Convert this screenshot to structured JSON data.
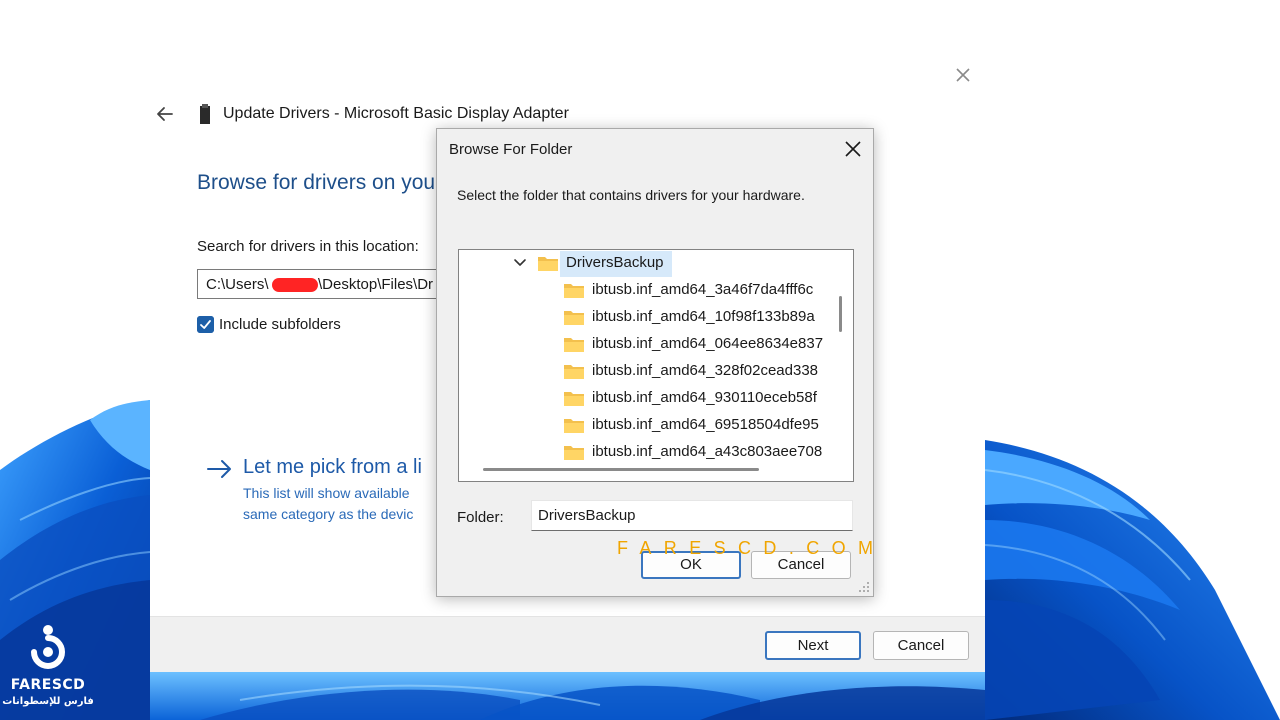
{
  "wizard": {
    "title": "Update Drivers - Microsoft Basic Display Adapter",
    "heading": "Browse for drivers on you",
    "search_label": "Search for drivers in this location:",
    "path_prefix": "C:\\Users\\",
    "path_suffix": "\\Desktop\\Files\\Dr",
    "include_subfolders_label": "Include subfolders",
    "include_subfolders_checked": true,
    "let_me_pick": "Let me pick from a li",
    "let_me_desc_line1": "This list will show available",
    "let_me_desc_line2": "same category as the devic",
    "next_label": "Next",
    "cancel_label": "Cancel"
  },
  "dialog": {
    "title": "Browse For Folder",
    "instruction": "Select the folder that contains drivers for your hardware.",
    "tree": {
      "selected": "DriversBackup",
      "children": [
        "ibtusb.inf_amd64_3a46f7da4fff6c",
        "ibtusb.inf_amd64_10f98f133b89a",
        "ibtusb.inf_amd64_064ee8634e837",
        "ibtusb.inf_amd64_328f02cead338",
        "ibtusb.inf_amd64_930110eceb58f",
        "ibtusb.inf_amd64_69518504dfe95",
        "ibtusb.inf_amd64_a43c803aee708"
      ]
    },
    "folder_label": "Folder:",
    "folder_value": "DriversBackup",
    "ok_label": "OK",
    "cancel_label": "Cancel"
  },
  "watermark": "FARESCD.COM",
  "logo": {
    "name": "FARESCD",
    "tagline": "فارس للإسطوانات"
  },
  "colors": {
    "accent": "#1e5aa8",
    "wallpaper_blue": "#0a5fd6",
    "redaction": "#ff2424",
    "watermark": "#f0a500"
  }
}
